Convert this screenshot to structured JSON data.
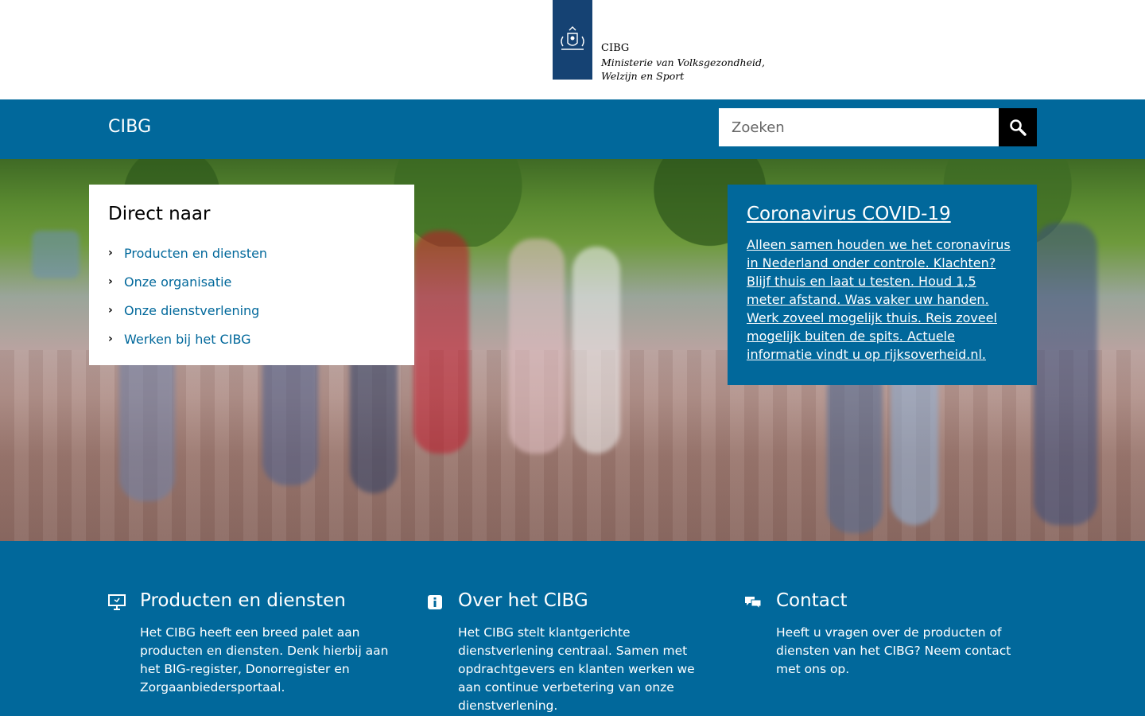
{
  "header": {
    "org_name": "CIBG",
    "ministry_line1": "Ministerie van Volksgezondheid,",
    "ministry_line2": "Welzijn en Sport"
  },
  "navbar": {
    "site_title": "CIBG",
    "search_placeholder": "Zoeken"
  },
  "direct": {
    "title": "Direct naar",
    "items": [
      {
        "label": "Producten en diensten"
      },
      {
        "label": "Onze organisatie"
      },
      {
        "label": "Onze dienstverlening"
      },
      {
        "label": "Werken bij het CIBG"
      }
    ]
  },
  "corona": {
    "title": "Coronavirus COVID-19",
    "text": "Alleen samen houden we het coronavirus in Nederland onder controle. Klachten? Blijf thuis en laat u testen. Houd 1,5 meter afstand. Was vaker uw handen. Werk zoveel mogelijk thuis. Reis zoveel mogelijk buiten de spits. Actuele informatie vindt u op rijksoverheid.nl."
  },
  "cards": [
    {
      "icon": "monitor-icon",
      "title": "Producten en diensten",
      "text": "Het CIBG heeft een breed palet aan producten en diensten. Denk hierbij aan het BIG-register, Donorregister en Zorgaanbiedersportaal."
    },
    {
      "icon": "info-icon",
      "title": "Over het CIBG",
      "text": "Het CIBG stelt klantgerichte dienstverlening centraal. Samen met opdrachtgevers en klanten werken we aan continue verbetering van onze dienstverlening."
    },
    {
      "icon": "chat-icon",
      "title": "Contact",
      "text": "Heeft u vragen over de producten of diensten van het CIBG? Neem contact met ons op."
    }
  ],
  "colors": {
    "brand_blue": "#01689b",
    "logo_blue": "#154273",
    "search_button": "#000000"
  }
}
